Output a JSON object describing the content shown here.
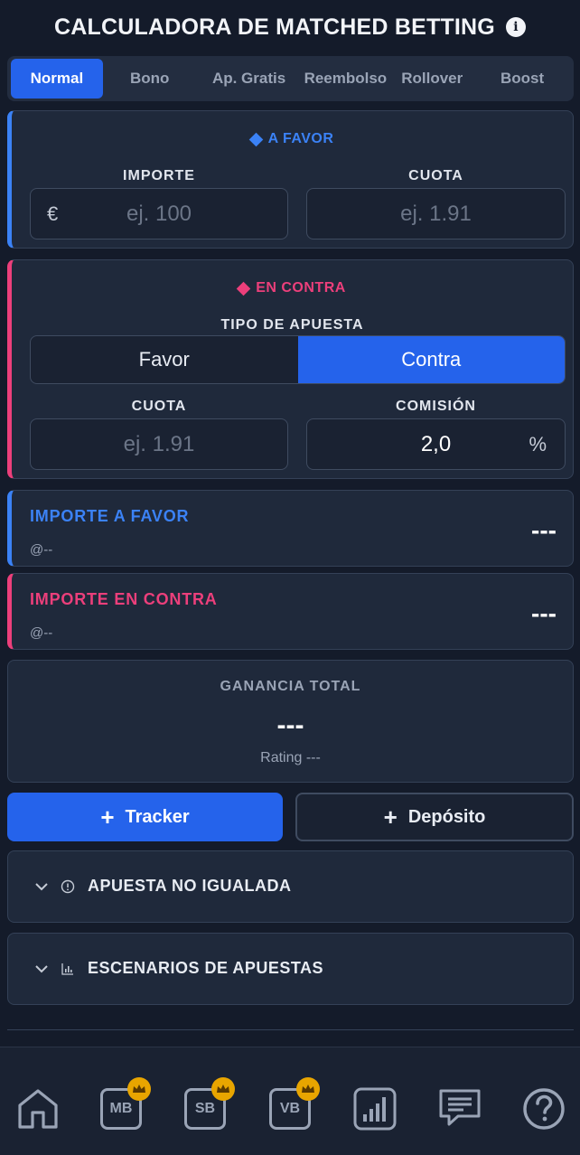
{
  "header": {
    "title": "CALCULADORA DE MATCHED BETTING",
    "info_glyph": "i"
  },
  "tabs": [
    {
      "label": "Normal",
      "active": true
    },
    {
      "label": "Bono",
      "active": false
    },
    {
      "label": "Ap. Gratis",
      "active": false
    },
    {
      "label": "Reembolso",
      "active": false
    },
    {
      "label": "Rollover",
      "active": false
    },
    {
      "label": "Boost",
      "active": false
    }
  ],
  "favor": {
    "title": "A FAVOR",
    "importe_label": "IMPORTE",
    "importe_prefix": "€",
    "importe_placeholder": "ej. 100",
    "cuota_label": "CUOTA",
    "cuota_placeholder": "ej. 1.91"
  },
  "contra": {
    "title": "EN CONTRA",
    "tipo_label": "TIPO DE APUESTA",
    "tipo_options": {
      "favor": "Favor",
      "contra": "Contra"
    },
    "cuota_label": "CUOTA",
    "cuota_placeholder": "ej. 1.91",
    "comision_label": "COMISIÓN",
    "comision_value": "2,0",
    "comision_suffix": "%"
  },
  "results": {
    "importe_favor": {
      "label": "IMPORTE A FAVOR",
      "sub": "@--",
      "value": "---"
    },
    "importe_contra": {
      "label": "IMPORTE EN CONTRA",
      "sub": "@--",
      "value": "---"
    }
  },
  "ganancia": {
    "label": "GANANCIA TOTAL",
    "value": "---",
    "rating": "Rating ---"
  },
  "buttons": {
    "tracker": "Tracker",
    "deposito": "Depósito",
    "plus": "+"
  },
  "accordions": {
    "no_igualada": "APUESTA NO IGUALADA",
    "escenarios": "ESCENARIOS DE APUESTAS"
  },
  "bottom_nav": {
    "mb": "MB",
    "sb": "SB",
    "vb": "VB"
  },
  "colors": {
    "accent_blue": "#2563eb",
    "favor_blue": "#3b82f6",
    "contra_pink": "#ec3f7b",
    "crown_gold": "#e8a500"
  }
}
